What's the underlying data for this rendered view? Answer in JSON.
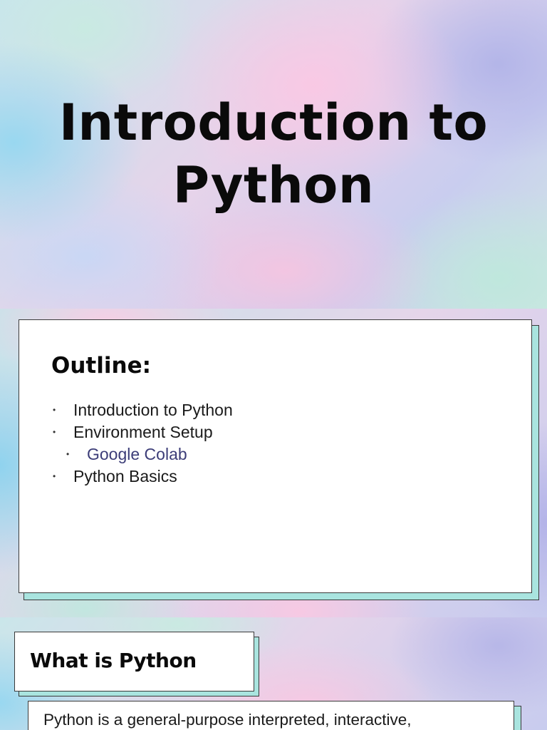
{
  "title_slide": {
    "line1": "Introduction to",
    "line2": "Python"
  },
  "outline_slide": {
    "heading": "Outline:",
    "items": [
      {
        "label": "Introduction to Python",
        "level": 1
      },
      {
        "label": "Environment Setup",
        "level": 1
      },
      {
        "label": "Google Colab",
        "level": 2
      },
      {
        "label": "Python Basics",
        "level": 1
      }
    ],
    "bullet": "•"
  },
  "what_slide": {
    "heading": "What is Python",
    "description": "Python is a general-purpose interpreted, interactive,"
  },
  "colors": {
    "text": "#0a0a0a",
    "link": "#3c3d78",
    "card_shadow": "#a9e4df",
    "card": "#ffffff"
  }
}
